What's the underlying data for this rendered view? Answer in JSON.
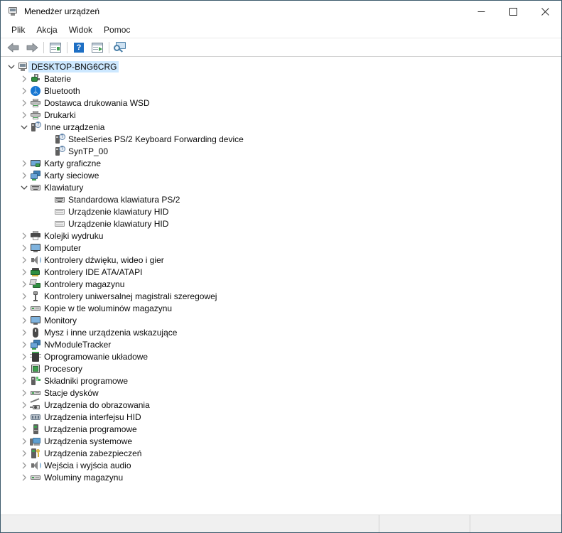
{
  "window": {
    "title": "Menedżer urządzeń",
    "title_icon": "device-manager-icon",
    "minimize_label": "—",
    "maximize_label": "☐",
    "close_label": "✕"
  },
  "menu": {
    "items": [
      {
        "label": "Plik",
        "name": "menu-plik"
      },
      {
        "label": "Akcja",
        "name": "menu-akcja"
      },
      {
        "label": "Widok",
        "name": "menu-widok"
      },
      {
        "label": "Pomoc",
        "name": "menu-pomoc"
      }
    ]
  },
  "toolbar": {
    "buttons": [
      {
        "name": "back-arrow-icon",
        "kind": "arrow-left"
      },
      {
        "name": "forward-arrow-icon",
        "kind": "arrow-right"
      },
      {
        "name": "sep",
        "kind": "separator"
      },
      {
        "name": "show-hide-console-tree-icon",
        "kind": "panel-left"
      },
      {
        "name": "sep",
        "kind": "separator"
      },
      {
        "name": "help-icon",
        "kind": "help"
      },
      {
        "name": "properties-icon",
        "kind": "panel-right"
      },
      {
        "name": "sep",
        "kind": "separator"
      },
      {
        "name": "scan-for-hardware-changes-icon",
        "kind": "scan"
      }
    ]
  },
  "tree": {
    "selected_index": 0,
    "nodes": [
      {
        "level": 0,
        "expander": "expanded",
        "icon": "computer-root-icon",
        "label": "DESKTOP-BNG6CRG",
        "selected": true
      },
      {
        "level": 1,
        "expander": "collapsed",
        "icon": "battery-icon",
        "label": "Baterie"
      },
      {
        "level": 1,
        "expander": "collapsed",
        "icon": "bluetooth-icon",
        "label": "Bluetooth"
      },
      {
        "level": 1,
        "expander": "collapsed",
        "icon": "printer-icon",
        "label": "Dostawca drukowania WSD"
      },
      {
        "level": 1,
        "expander": "collapsed",
        "icon": "printer-icon",
        "label": "Drukarki"
      },
      {
        "level": 1,
        "expander": "expanded",
        "icon": "unknown-device-icon",
        "label": "Inne urządzenia"
      },
      {
        "level": 2,
        "expander": "none",
        "icon": "unknown-device-icon",
        "label": "SteelSeries PS/2 Keyboard Forwarding device"
      },
      {
        "level": 2,
        "expander": "none",
        "icon": "unknown-device-icon",
        "label": "SynTP_00"
      },
      {
        "level": 1,
        "expander": "collapsed",
        "icon": "display-adapter-icon",
        "label": "Karty graficzne"
      },
      {
        "level": 1,
        "expander": "collapsed",
        "icon": "network-adapter-icon",
        "label": "Karty sieciowe"
      },
      {
        "level": 1,
        "expander": "expanded",
        "icon": "keyboard-icon",
        "label": "Klawiatury"
      },
      {
        "level": 2,
        "expander": "none",
        "icon": "keyboard-icon",
        "label": "Standardowa klawiatura PS/2"
      },
      {
        "level": 2,
        "expander": "none",
        "icon": "keyboard-hid-icon",
        "label": "Urządzenie klawiatury HID"
      },
      {
        "level": 2,
        "expander": "none",
        "icon": "keyboard-hid-icon",
        "label": "Urządzenie klawiatury HID"
      },
      {
        "level": 1,
        "expander": "collapsed",
        "icon": "print-queue-icon",
        "label": "Kolejki wydruku"
      },
      {
        "level": 1,
        "expander": "collapsed",
        "icon": "monitor-icon",
        "label": "Komputer"
      },
      {
        "level": 1,
        "expander": "collapsed",
        "icon": "sound-icon",
        "label": "Kontrolery dźwięku, wideo i gier"
      },
      {
        "level": 1,
        "expander": "collapsed",
        "icon": "ide-controller-icon",
        "label": "Kontrolery IDE ATA/ATAPI"
      },
      {
        "level": 1,
        "expander": "collapsed",
        "icon": "storage-controller-icon",
        "label": "Kontrolery magazynu"
      },
      {
        "level": 1,
        "expander": "collapsed",
        "icon": "usb-icon",
        "label": "Kontrolery uniwersalnej magistrali szeregowej"
      },
      {
        "level": 1,
        "expander": "collapsed",
        "icon": "disk-icon",
        "label": "Kopie w tle woluminów magazynu"
      },
      {
        "level": 1,
        "expander": "collapsed",
        "icon": "monitor-icon",
        "label": "Monitory"
      },
      {
        "level": 1,
        "expander": "collapsed",
        "icon": "mouse-icon",
        "label": "Mysz i inne urządzenia wskazujące"
      },
      {
        "level": 1,
        "expander": "collapsed",
        "icon": "network-adapter-icon",
        "label": "NvModuleTracker"
      },
      {
        "level": 1,
        "expander": "collapsed",
        "icon": "firmware-icon",
        "label": "Oprogramowanie układowe"
      },
      {
        "level": 1,
        "expander": "collapsed",
        "icon": "processor-icon",
        "label": "Procesory"
      },
      {
        "level": 1,
        "expander": "collapsed",
        "icon": "software-component-icon",
        "label": "Składniki programowe"
      },
      {
        "level": 1,
        "expander": "collapsed",
        "icon": "disk-icon",
        "label": "Stacje dysków"
      },
      {
        "level": 1,
        "expander": "collapsed",
        "icon": "imaging-device-icon",
        "label": "Urządzenia do obrazowania"
      },
      {
        "level": 1,
        "expander": "collapsed",
        "icon": "hid-icon",
        "label": "Urządzenia interfejsu HID"
      },
      {
        "level": 1,
        "expander": "collapsed",
        "icon": "software-device-icon",
        "label": "Urządzenia programowe"
      },
      {
        "level": 1,
        "expander": "collapsed",
        "icon": "system-device-icon",
        "label": "Urządzenia systemowe"
      },
      {
        "level": 1,
        "expander": "collapsed",
        "icon": "security-device-icon",
        "label": "Urządzenia zabezpieczeń"
      },
      {
        "level": 1,
        "expander": "collapsed",
        "icon": "sound-icon",
        "label": "Wejścia i wyjścia audio"
      },
      {
        "level": 1,
        "expander": "collapsed",
        "icon": "disk-icon",
        "label": "Woluminy magazynu"
      }
    ]
  },
  "statusbar": {
    "pane1": "",
    "pane2": "",
    "pane3": ""
  },
  "colors": {
    "window_border": "#3d5a6c",
    "selection": "#cde8ff",
    "text": "#0b0b0b",
    "statusbar_bg": "#f0f0f0"
  }
}
